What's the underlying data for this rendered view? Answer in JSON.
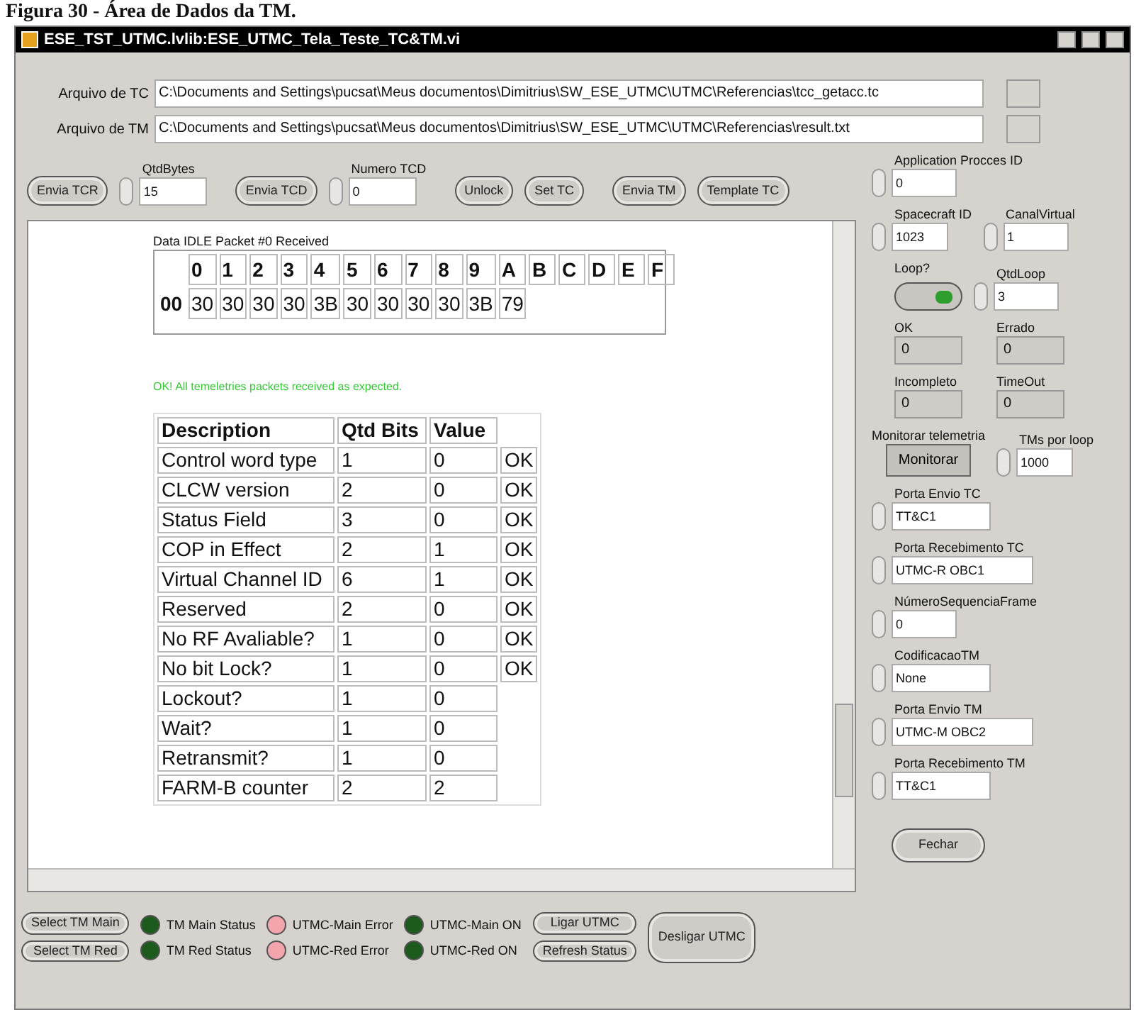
{
  "caption": "Figura 30 - Área de Dados da TM.",
  "window": {
    "title": "ESE_TST_UTMC.lvlib:ESE_UTMC_Tela_Teste_TC&TM.vi"
  },
  "files": [
    {
      "label": "Arquivo de TC",
      "path": "C:\\Documents and Settings\\pucsat\\Meus documentos\\Dimitrius\\SW_ESE_UTMC\\UTMC\\Referencias\\tcc_getacc.tc"
    },
    {
      "label": "Arquivo de TM",
      "path": "C:\\Documents and Settings\\pucsat\\Meus documentos\\Dimitrius\\SW_ESE_UTMC\\UTMC\\Referencias\\result.txt"
    }
  ],
  "toolbar": [
    {
      "kind": "button",
      "label": "Envia TCR"
    },
    {
      "kind": "numeric",
      "label": "QtdBytes",
      "value": "15"
    },
    {
      "kind": "button",
      "label": "Envia TCD"
    },
    {
      "kind": "numeric",
      "label": "Numero TCD",
      "value": "0"
    },
    {
      "kind": "button",
      "label": "Unlock"
    },
    {
      "kind": "button",
      "label": "Set TC"
    },
    {
      "kind": "button",
      "label": "Envia TM"
    },
    {
      "kind": "button",
      "label": "Template TC"
    }
  ],
  "data_panel": {
    "packet_title": "Data IDLE Packet #0 Received",
    "hex_table": {
      "columns": [
        "0",
        "1",
        "2",
        "3",
        "4",
        "5",
        "6",
        "7",
        "8",
        "9",
        "A",
        "B",
        "C",
        "D",
        "E",
        "F"
      ],
      "rows": [
        {
          "header": "00",
          "cells": [
            "30",
            "30",
            "30",
            "30",
            "3B",
            "30",
            "30",
            "30",
            "30",
            "3B",
            "79"
          ]
        }
      ]
    },
    "message": "OK! All temeletries packets received as expected.",
    "fields_table": {
      "columns": [
        "Description",
        "Qtd Bits",
        "Value"
      ],
      "rows": [
        {
          "description": "Control word type",
          "bits": "1",
          "value": "0",
          "status": "OK"
        },
        {
          "description": "CLCW version",
          "bits": "2",
          "value": "0",
          "status": "OK"
        },
        {
          "description": "Status Field",
          "bits": "3",
          "value": "0",
          "status": "OK"
        },
        {
          "description": "COP in Effect",
          "bits": "2",
          "value": "1",
          "status": "OK"
        },
        {
          "description": "Virtual Channel ID",
          "bits": "6",
          "value": "1",
          "status": "OK"
        },
        {
          "description": "Reserved",
          "bits": "2",
          "value": "0",
          "status": "OK"
        },
        {
          "description": "No RF Avaliable?",
          "bits": "1",
          "value": "0",
          "status": "OK"
        },
        {
          "description": "No bit Lock?",
          "bits": "1",
          "value": "0",
          "status": "OK"
        },
        {
          "description": "Lockout?",
          "bits": "1",
          "value": "0"
        },
        {
          "description": "Wait?",
          "bits": "1",
          "value": "0"
        },
        {
          "description": "Retransmit?",
          "bits": "1",
          "value": "0"
        },
        {
          "description": "FARM-B counter",
          "bits": "2",
          "value": "2"
        }
      ]
    }
  },
  "right_panel": [
    [
      {
        "kind": "numeric",
        "label": "Application Procces ID",
        "value": "0"
      }
    ],
    [
      {
        "kind": "numeric",
        "label": "Spacecraft ID",
        "value": "1023"
      },
      {
        "kind": "numeric",
        "label": "CanalVirtual",
        "value": "1"
      }
    ],
    [
      {
        "kind": "toggle",
        "label": "Loop?",
        "on": true
      },
      {
        "kind": "numeric",
        "label": "QtdLoop",
        "value": "3"
      }
    ],
    [
      {
        "kind": "indicator",
        "label": "OK",
        "value": "0"
      },
      {
        "kind": "indicator",
        "label": "Errado",
        "value": "0"
      }
    ],
    [
      {
        "kind": "indicator",
        "label": "Incompleto",
        "value": "0"
      },
      {
        "kind": "indicator",
        "label": "TimeOut",
        "value": "0"
      }
    ],
    [
      {
        "kind": "button",
        "label": "Monitorar telemetria",
        "text": "Monitorar"
      },
      {
        "kind": "numeric",
        "label": "TMs por loop",
        "value": "1000"
      }
    ],
    [
      {
        "kind": "string",
        "label": "Porta Envio TC",
        "value": "TT&C1"
      }
    ],
    [
      {
        "kind": "string",
        "label": "Porta Recebimento TC",
        "value": "UTMC-R OBC1"
      }
    ],
    [
      {
        "kind": "numeric",
        "label": "NúmeroSequenciaFrame",
        "value": "0"
      }
    ],
    [
      {
        "kind": "string",
        "label": "CodificacaoTM",
        "value": "None"
      }
    ],
    [
      {
        "kind": "string",
        "label": "Porta Envio TM",
        "value": "UTMC-M OBC2"
      }
    ],
    [
      {
        "kind": "string",
        "label": "Porta Recebimento TM",
        "value": "TT&C1"
      }
    ],
    [
      {
        "kind": "close",
        "text": "Fechar"
      }
    ]
  ],
  "status_bar": [
    [
      {
        "kind": "button",
        "label": "Select TM Main"
      },
      {
        "kind": "button",
        "label": "Select TM Red"
      }
    ],
    [
      {
        "kind": "led",
        "label": "TM Main Status",
        "color": "#1d5a1d"
      },
      {
        "kind": "led",
        "label": "TM Red Status",
        "color": "#1d5a1d"
      }
    ],
    [
      {
        "kind": "led",
        "label": "UTMC-Main Error",
        "color": "#f2a5ad"
      },
      {
        "kind": "led",
        "label": "UTMC-Red Error",
        "color": "#f2a5ad"
      }
    ],
    [
      {
        "kind": "led",
        "label": "UTMC-Main ON",
        "color": "#1d5a1d"
      },
      {
        "kind": "led",
        "label": "UTMC-Red ON",
        "color": "#1d5a1d"
      }
    ],
    [
      {
        "kind": "button",
        "label": "Ligar UTMC"
      },
      {
        "kind": "button",
        "label": "Refresh Status"
      }
    ],
    [
      {
        "kind": "bigbutton",
        "label": "Desligar UTMC"
      }
    ]
  ]
}
